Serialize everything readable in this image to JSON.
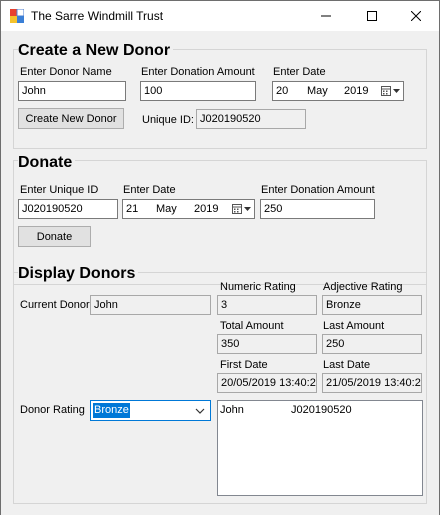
{
  "window": {
    "title": "The Sarre Windmill Trust"
  },
  "create": {
    "heading": "Create a New Donor",
    "name_label": "Enter Donor Name",
    "name_value": "John",
    "amount_label": "Enter Donation Amount",
    "amount_value": "100",
    "date_label": "Enter Date",
    "date_day": "20",
    "date_month": "May",
    "date_year": "2019",
    "button": "Create New Donor",
    "uid_label": "Unique ID:",
    "uid_value": "J020190520"
  },
  "donate": {
    "heading": "Donate",
    "uid_label": "Enter Unique ID",
    "uid_value": "J020190520",
    "date_label": "Enter Date",
    "date_day": "21",
    "date_month": "May",
    "date_year": "2019",
    "amount_label": "Enter Donation Amount",
    "amount_value": "250",
    "button": "Donate"
  },
  "display": {
    "heading": "Display Donors",
    "current_label": "Current Donor",
    "current_value": "John",
    "numeric_label": "Numeric Rating",
    "numeric_value": "3",
    "adjective_label": "Adjective Rating",
    "adjective_value": "Bronze",
    "total_label": "Total Amount",
    "total_value": "350",
    "last_label": "Last Amount",
    "last_value": "250",
    "first_date_label": "First Date",
    "first_date_value": "20/05/2019 13:40:2",
    "last_date_label": "Last Date",
    "last_date_value": "21/05/2019 13:40:2",
    "rating_label": "Donor Rating",
    "rating_value": "Bronze",
    "list": [
      {
        "name": "John",
        "id": "J020190520"
      }
    ]
  }
}
